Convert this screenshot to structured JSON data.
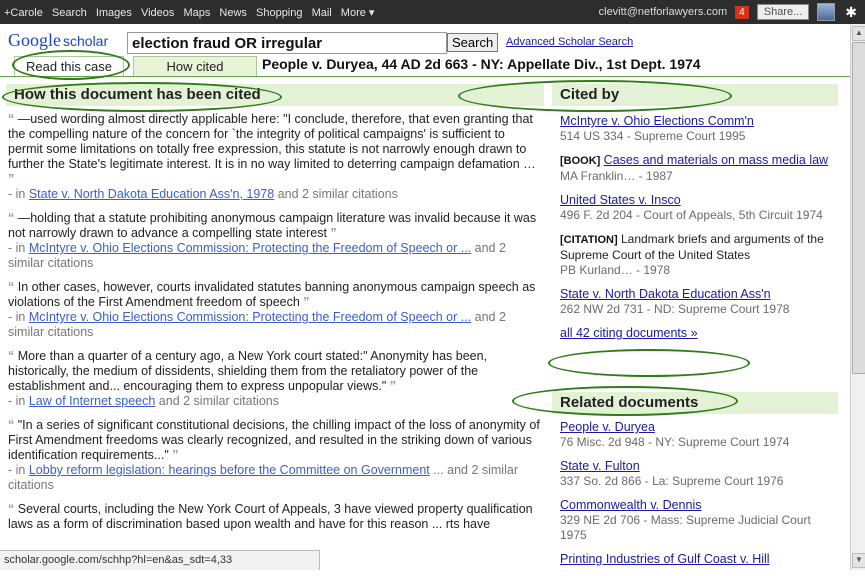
{
  "topbar": {
    "nav": [
      "+Carole",
      "Search",
      "Images",
      "Videos",
      "Maps",
      "News",
      "Shopping",
      "Mail",
      "More ▾"
    ],
    "email": "clevitt@netforlawyers.com",
    "badge_count": "4",
    "share_label": "Share..."
  },
  "header": {
    "logo_google": "Google",
    "logo_scholar": "scholar",
    "search_value": "election fraud OR irregular",
    "search_button": "Search",
    "advanced_link": "Advanced Scholar Search",
    "tab_read": "Read this case",
    "tab_cited": "How cited",
    "case_title": "People v. Duryea, 44 AD 2d 663 - NY: Appellate Div., 1st Dept. 1974"
  },
  "left": {
    "heading": "How this document has been cited",
    "citations": [
      {
        "text": "—used wording almost directly applicable here: \"I conclude, therefore, that even granting that the compelling nature of the concern for `the integrity of political campaigns' is sufficient to permit some limitations on totally free expression, this statute is not narrowly enough drawn to further the State's legitimate interest. It is in no way limited to deterring campaign defamation …",
        "in_prefix": "- in ",
        "source": "State v. North Dakota Education Ass'n, 1978",
        "suffix": " and 2 similar citations"
      },
      {
        "text": "—holding that a statute prohibiting anonymous campaign literature was invalid because it was not narrowly drawn to advance a compelling state interest",
        "in_prefix": "- in ",
        "source": "McIntyre v. Ohio Elections Commission: Protecting the Freedom of Speech or ...",
        "suffix": " and 2 similar citations"
      },
      {
        "text": "In other cases, however, courts invalidated statutes banning anonymous campaign speech as violations of the First Amendment freedom of speech",
        "in_prefix": "- in ",
        "source": "McIntyre v. Ohio Elections Commission: Protecting the Freedom of Speech or ...",
        "suffix": " and 2 similar citations"
      },
      {
        "text": "More than a quarter of a century ago, a New York court stated:\" Anonymity has been, historically, the medium of dissidents, shielding them from the retaliatory power of the establishment and... encouraging them to express unpopular views.\"",
        "in_prefix": "- in ",
        "source": "Law of Internet speech",
        "suffix": " and 2 similar citations"
      },
      {
        "text": "\"In a series of significant constitutional decisions, the chilling impact of the loss of anonymity of First Amendment freedoms was clearly recognized, and resulted in the striking down of various identification requirements...\"",
        "in_prefix": "- in ",
        "source": "Lobby reform legislation: hearings before the Committee on Government",
        "suffix": " ... and 2 similar citations"
      },
      {
        "text": "Several courts, including the New York Court of Appeals, 3 have viewed property qualification laws as a form of discrimination based upon wealth and have for this reason ... rts have",
        "in_prefix": "",
        "source": "",
        "suffix": ""
      }
    ]
  },
  "cited_by": {
    "heading": "Cited by",
    "items": [
      {
        "tag": "",
        "link": "McIntyre v. Ohio Elections Comm'n",
        "meta": "514 US 334 - Supreme Court 1995"
      },
      {
        "tag": "[BOOK]",
        "link": "Cases and materials on mass media law",
        "meta": "MA Franklin… - 1987"
      },
      {
        "tag": "",
        "link": "United States v. Insco",
        "meta": "496 F. 2d 204 - Court of Appeals, 5th Circuit 1974"
      },
      {
        "tag": "[CITATION]",
        "link": "",
        "plain": "Landmark briefs and arguments of the Supreme Court of the United States",
        "meta": "PB Kurland… - 1978"
      },
      {
        "tag": "",
        "link": "State v. North Dakota Education Ass'n",
        "meta": "262 NW 2d 731 - ND: Supreme Court 1978"
      }
    ],
    "all_link": "all 42 citing documents »"
  },
  "related": {
    "heading": "Related documents",
    "items": [
      {
        "link": "People v. Duryea",
        "meta": "76 Misc. 2d 948 - NY: Supreme Court 1974"
      },
      {
        "link": "State v. Fulton",
        "meta": "337 So. 2d 866 - La: Supreme Court 1976"
      },
      {
        "link": "Commonwealth v. Dennis",
        "meta": "329 NE 2d 706 - Mass: Supreme Judicial Court 1975"
      },
      {
        "link": "Printing Industries of Gulf Coast v. Hill",
        "meta": ""
      }
    ]
  },
  "status": {
    "url": "scholar.google.com/schhp?hl=en&as_sdt=4,33"
  }
}
